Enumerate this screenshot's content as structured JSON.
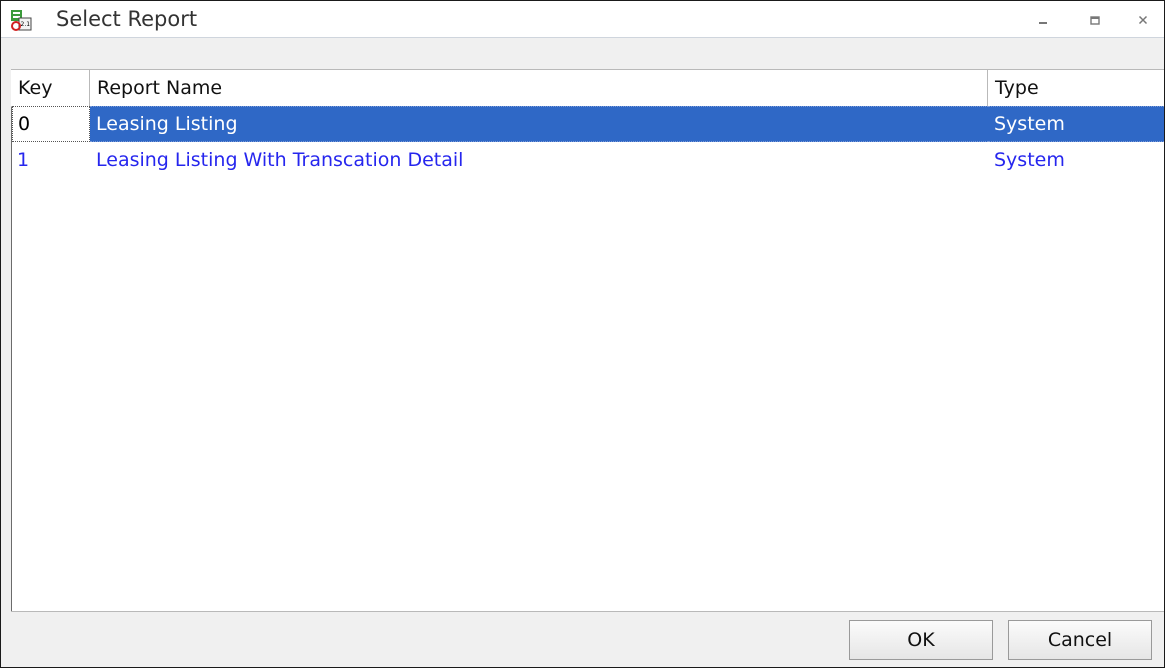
{
  "window": {
    "title": "Select Report",
    "icon": "report-app-icon",
    "controls": {
      "minimize_icon": "minimize-icon",
      "maximize_icon": "maximize-icon",
      "close_icon": "close-icon"
    }
  },
  "grid": {
    "columns": [
      "Key",
      "Report Name",
      "Type"
    ],
    "rows": [
      {
        "key": "0",
        "name": "Leasing Listing",
        "type": "System",
        "selected": true
      },
      {
        "key": "1",
        "name": "Leasing Listing With Transcation Detail",
        "type": "System",
        "selected": false
      }
    ]
  },
  "buttons": {
    "ok_label": "OK",
    "cancel_label": "Cancel"
  },
  "colors": {
    "selection": "#2f68c6",
    "row_text": "#2626ee"
  }
}
